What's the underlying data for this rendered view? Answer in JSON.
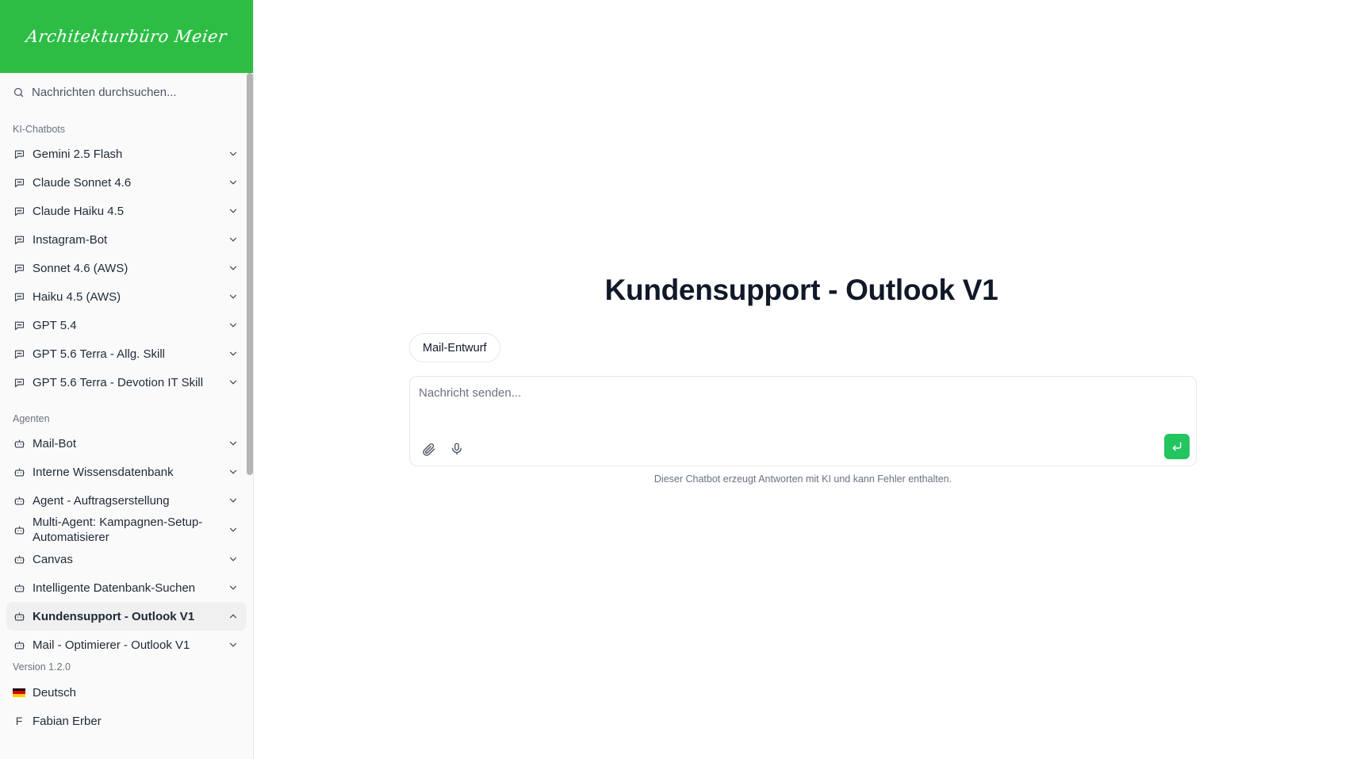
{
  "brand": {
    "logo_text": "Architekturbüro Meier",
    "accent": "#2dbd45"
  },
  "search": {
    "placeholder": "Nachrichten durchsuchen..."
  },
  "sidebar": {
    "chatbots_label": "KI-Chatbots",
    "chatbots": [
      {
        "label": "Gemini 2.5 Flash"
      },
      {
        "label": "Claude Sonnet 4.6"
      },
      {
        "label": "Claude Haiku 4.5"
      },
      {
        "label": "Instagram-Bot"
      },
      {
        "label": "Sonnet 4.6 (AWS)"
      },
      {
        "label": "Haiku 4.5 (AWS)"
      },
      {
        "label": "GPT 5.4"
      },
      {
        "label": "GPT 5.6 Terra - Allg. Skill"
      },
      {
        "label": "GPT 5.6 Terra - Devotion IT Skill"
      }
    ],
    "agents_label": "Agenten",
    "agents": [
      {
        "label": "Mail-Bot"
      },
      {
        "label": "Interne Wissensdatenbank"
      },
      {
        "label": "Agent - Auftragserstellung"
      },
      {
        "label": "Multi-Agent: Kampagnen-Setup-Automatisierer"
      },
      {
        "label": "Canvas"
      },
      {
        "label": "Intelligente Datenbank-Suchen"
      },
      {
        "label": "Kundensupport - Outlook V1"
      },
      {
        "label": "Mail - Optimierer - Outlook V1"
      }
    ],
    "version": "Version 1.2.0",
    "language": "Deutsch",
    "user_initial": "F",
    "user_name": "Fabian Erber"
  },
  "main": {
    "title": "Kundensupport - Outlook V1",
    "chip_label": "Mail-Entwurf",
    "composer_placeholder": "Nachricht senden...",
    "disclaimer": "Dieser Chatbot erzeugt Antworten mit KI und kann Fehler enthalten.",
    "send_color": "#22c55e"
  },
  "icons": {
    "search": "search-icon",
    "chat": "message-square-icon",
    "agent": "bot-icon",
    "chevron": "chevron-down-icon",
    "attach": "paperclip-icon",
    "mic": "microphone-icon",
    "send": "enter-arrow-icon"
  }
}
